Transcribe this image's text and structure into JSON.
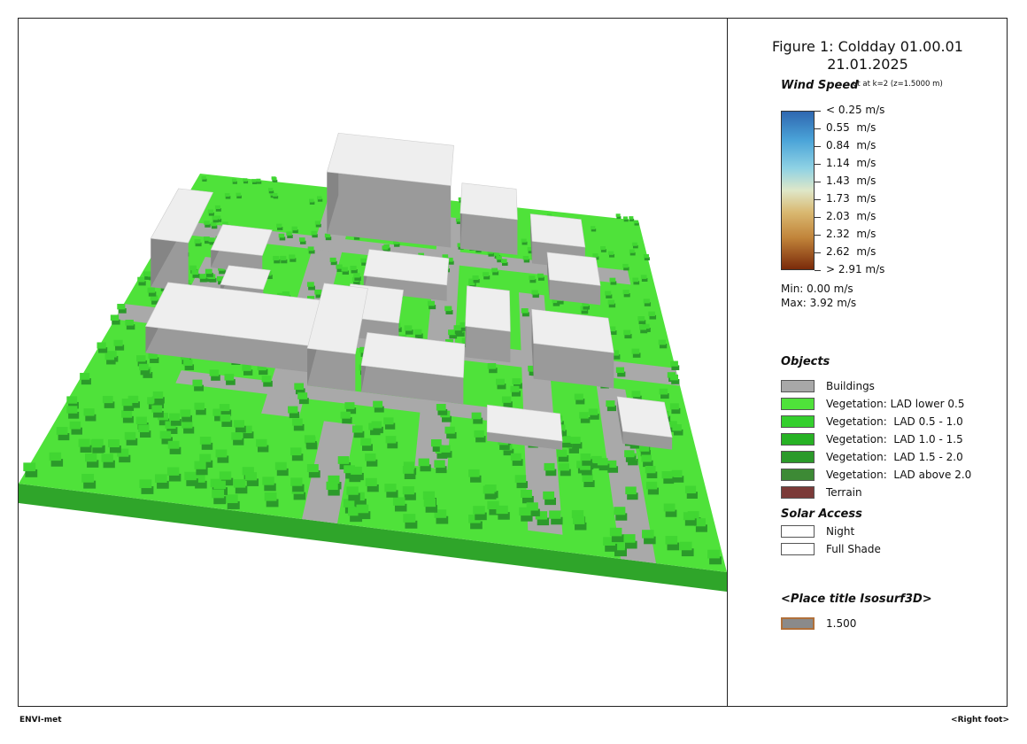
{
  "figure": {
    "title_line1": "Figure 1: Coldday 01.00.01",
    "title_line2": "21.01.2025"
  },
  "wind_speed": {
    "heading": "Wind Speed",
    "subtitle": "ut at k=2 (z=1.5000 m)",
    "labels": [
      "< 0.25 m/s",
      "0.55  m/s",
      "0.84  m/s",
      "1.14  m/s",
      "1.43  m/s",
      "1.73  m/s",
      "2.03  m/s",
      "2.32  m/s",
      "2.62  m/s",
      "> 2.91 m/s"
    ],
    "min": "Min: 0.00 m/s",
    "max": "Max: 3.92 m/s",
    "colors": [
      "#2f67b0",
      "#4aa3d8",
      "#8fd2e4",
      "#dfe7c8",
      "#d9b870",
      "#c1843a",
      "#7a2a0a"
    ]
  },
  "objects": {
    "heading": "Objects",
    "items": [
      {
        "label": "Buildings",
        "color": "#a8a8a8"
      },
      {
        "label": "Vegetation: LAD lower 0.5",
        "color": "#4fe23a"
      },
      {
        "label": "Vegetation:  LAD 0.5 - 1.0",
        "color": "#34cf2d"
      },
      {
        "label": "Vegetation:  LAD 1.0 - 1.5",
        "color": "#27b224"
      },
      {
        "label": "Vegetation:  LAD 1.5 - 2.0",
        "color": "#2b9a2a"
      },
      {
        "label": "Vegetation:  LAD above 2.0",
        "color": "#3d8a35"
      },
      {
        "label": "Terrain",
        "color": "#7b3a38"
      }
    ]
  },
  "solar_access": {
    "heading": "Solar Access",
    "items": [
      {
        "label": "Night",
        "color": "#ffffff"
      },
      {
        "label": "Full Shade",
        "color": "#ffffff"
      }
    ]
  },
  "isosurf": {
    "heading": "<Place title Isosurf3D>",
    "value_label": "1.500",
    "color": "#8a8a8a",
    "border": "#b0703a"
  },
  "footer": {
    "left": "ENVI-met",
    "right": "<Right foot>"
  },
  "map_colors": {
    "ground": "#4fe23a",
    "ground_edge": "#2fa52a",
    "road": "#a9a9a9",
    "building_top": "#eeeeee",
    "building_side": "#9a9a9a",
    "building_side_dark": "#858585",
    "tree": "#41d632",
    "tree_dark": "#2b9a2a"
  }
}
